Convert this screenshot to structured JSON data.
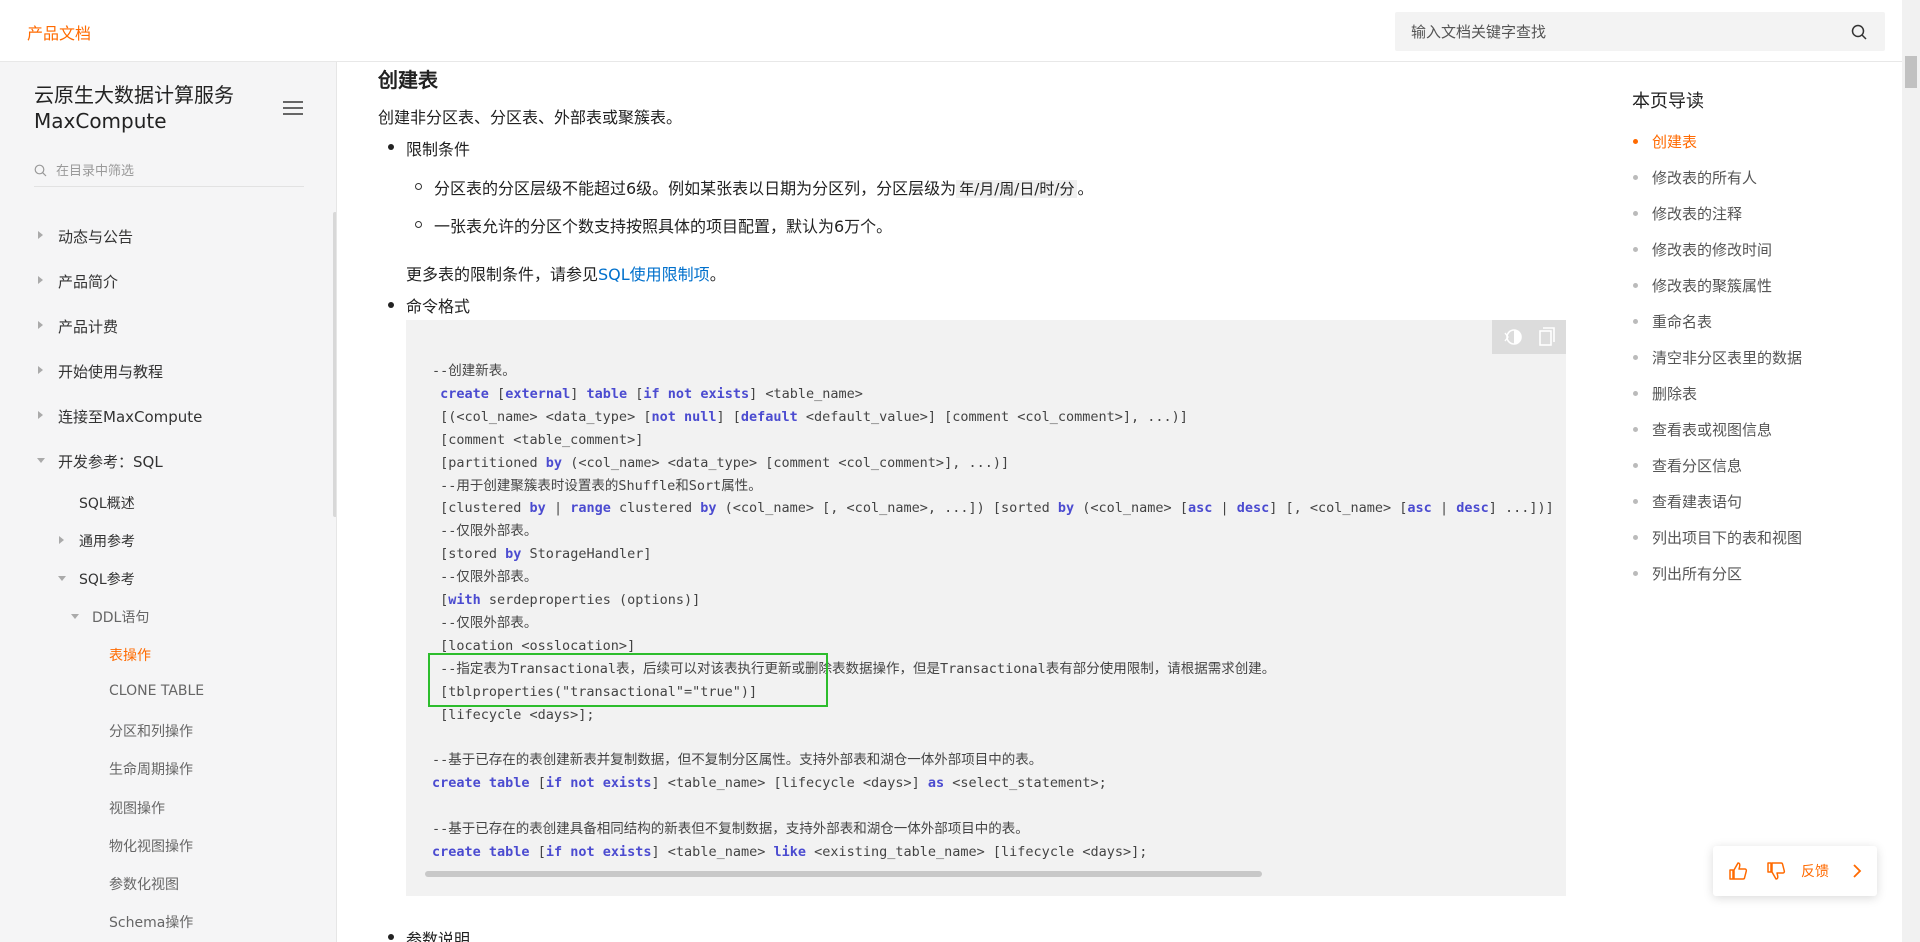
{
  "header": {
    "brand": "产品文档",
    "search_placeholder": "输入文档关键字查找"
  },
  "sidebar": {
    "title_line1": "云原生大数据计算服务",
    "title_line2": "MaxCompute",
    "filter_placeholder": "在目录中筛选",
    "items": [
      {
        "label": "动态与公告"
      },
      {
        "label": "产品简介"
      },
      {
        "label": "产品计费"
      },
      {
        "label": "开始使用与教程"
      },
      {
        "label": "连接至MaxCompute"
      },
      {
        "label": "开发参考：SQL"
      },
      {
        "label": "SQL概述"
      },
      {
        "label": "通用参考"
      },
      {
        "label": "SQL参考"
      },
      {
        "label": "DDL语句"
      },
      {
        "label": "表操作"
      },
      {
        "label": "CLONE TABLE"
      },
      {
        "label": "分区和列操作"
      },
      {
        "label": "生命周期操作"
      },
      {
        "label": "视图操作"
      },
      {
        "label": "物化视图操作"
      },
      {
        "label": "参数化视图"
      },
      {
        "label": "Schema操作"
      }
    ]
  },
  "main": {
    "heading": "创建表",
    "intro": "创建非分区表、分区表、外部表或聚簇表。",
    "bullet1": "限制条件",
    "limit1_pre": "分区表的分区层级不能超过6级。例如某张表以日期为分区列，分区层级为",
    "limit1_code": "年/月/周/日/时/分",
    "limit1_post": "。",
    "limit2": "一张表允许的分区个数支持按照具体的项目配置，默认为6万个。",
    "more_pre": "更多表的限制条件，请参见",
    "more_link": "SQL使用限制项",
    "more_post": "。",
    "bullet2": "命令格式",
    "bullet3": "参数说明"
  },
  "toc": {
    "title": "本页导读",
    "items": [
      {
        "label": "创建表"
      },
      {
        "label": "修改表的所有人"
      },
      {
        "label": "修改表的注释"
      },
      {
        "label": "修改表的修改时间"
      },
      {
        "label": "修改表的聚簇属性"
      },
      {
        "label": "重命名表"
      },
      {
        "label": "清空非分区表里的数据"
      },
      {
        "label": "删除表"
      },
      {
        "label": "查看表或视图信息"
      },
      {
        "label": "查看分区信息"
      },
      {
        "label": "查看建表语句"
      },
      {
        "label": "列出项目下的表和视图"
      },
      {
        "label": "列出所有分区"
      }
    ]
  },
  "feedback": {
    "label": "反馈"
  },
  "colors": {
    "accent": "#ff6a00",
    "link": "#0070cc",
    "keyword": "#4b4bd0",
    "highlight_box": "#2dbd2d"
  }
}
